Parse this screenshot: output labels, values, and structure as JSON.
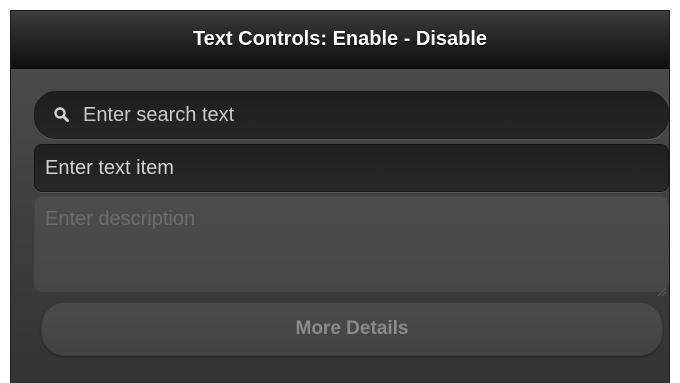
{
  "header": {
    "title": "Text Controls: Enable - Disable"
  },
  "search": {
    "placeholder": "Enter search text",
    "icon": "search-icon"
  },
  "text_item": {
    "placeholder": "Enter text item"
  },
  "description": {
    "placeholder": "Enter description"
  },
  "details_button": {
    "label": "More Details"
  },
  "colors": {
    "header_bg": "#1a1a1a",
    "page_bg": "#474747",
    "header_text": "#ffffff",
    "disabled_text": "#8a8a8a"
  }
}
